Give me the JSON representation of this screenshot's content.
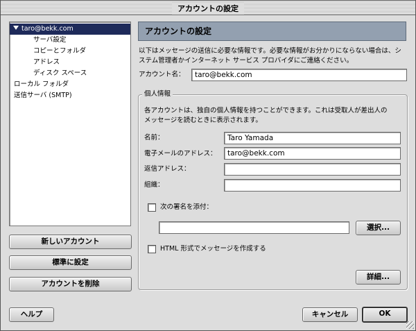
{
  "window": {
    "title": "アカウントの設定"
  },
  "sidebar": {
    "account": "taro@bekk.com",
    "children": [
      "サーバ設定",
      "コピーとフォルダ",
      "アドレス",
      "ディスク スペース"
    ],
    "local_folders": "ローカル フォルダ",
    "smtp": "送信サーバ (SMTP)"
  },
  "left_buttons": {
    "new_account": "新しいアカウント",
    "set_default": "標準に設定",
    "delete_account": "アカウントを削除"
  },
  "panel": {
    "title": "アカウントの設定",
    "intro_line1": "以下はメッセージの送信に必要な情報です。必要な情報がお分かりにならない場合は、シ",
    "intro_line2": "ステム管理者かインターネット サービス プロバイダにご連絡ください。",
    "account_name_label": "アカウント名：",
    "account_name_value": "taro@bekk.com"
  },
  "identity": {
    "group_label": "個人情報",
    "desc_line1": "各アカウントは、独自の個人情報を持つことができます。これは受取人が差出人の",
    "desc_line2": "メッセージを読むときに表示されます。",
    "name_label": "名前：",
    "name_value": "Taro Yamada",
    "email_label": "電子メールのアドレス：",
    "email_value": "taro@bekk.com",
    "reply_label": "返信アドレス：",
    "reply_value": "",
    "org_label": "組織：",
    "org_value": "",
    "signature_label": "次の署名を添付：",
    "signature_path": "",
    "choose_button": "選択...",
    "html_label": "HTML 形式でメッセージを作成する",
    "advanced_button": "詳細..."
  },
  "footer": {
    "help_button": "ヘルプ",
    "cancel_button": "キャンセル",
    "ok_button": "OK"
  }
}
